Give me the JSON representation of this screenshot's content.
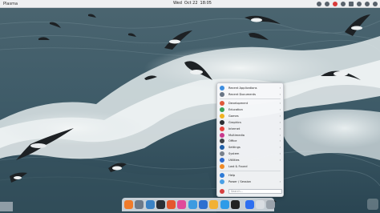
{
  "top_panel": {
    "activities_label": "Plasma",
    "clock": {
      "day": "Wed",
      "date": "Oct 22",
      "time": "18:05"
    }
  },
  "app_menu": {
    "items": [
      {
        "label": "Recent Applications",
        "color": "#3d8ee0",
        "arrow": "›"
      },
      {
        "label": "Recent Documents",
        "color": "#6a7686",
        "arrow": "›"
      },
      {
        "label": "Development",
        "color": "#e05a3b",
        "arrow": "›"
      },
      {
        "label": "Education",
        "color": "#3aa15a",
        "arrow": "›"
      },
      {
        "label": "Games",
        "color": "#f0b323",
        "arrow": "›"
      },
      {
        "label": "Graphics",
        "color": "#2c2f33",
        "arrow": "›"
      },
      {
        "label": "Internet",
        "color": "#e8453c",
        "arrow": "›"
      },
      {
        "label": "Multimedia",
        "color": "#c93a8d",
        "arrow": "›"
      },
      {
        "label": "Office",
        "color": "#3f4348",
        "arrow": "›"
      },
      {
        "label": "Settings",
        "color": "#1f5fa8",
        "arrow": "›"
      },
      {
        "label": "System",
        "color": "#7a828c",
        "arrow": "›"
      },
      {
        "label": "Utilities",
        "color": "#2e6bd0",
        "arrow": "›"
      },
      {
        "label": "Lost & Found",
        "color": "#f08a24",
        "arrow": ""
      },
      {
        "label": "Help",
        "color": "#2e7bd6",
        "arrow": ""
      },
      {
        "label": "Power / Session",
        "color": "#4aa0e6",
        "arrow": "›"
      }
    ],
    "search_placeholder": "Search..."
  },
  "dock": {
    "icons": [
      {
        "name": "firefox-icon",
        "color": "#f07b2a"
      },
      {
        "name": "files-icon",
        "color": "#6c7a8a"
      },
      {
        "name": "settings-icon",
        "color": "#3b82c4"
      },
      {
        "name": "terminal-icon",
        "color": "#2b2f36"
      },
      {
        "name": "browser-icon",
        "color": "#e4572e"
      },
      {
        "name": "music-icon",
        "color": "#e04a9a"
      },
      {
        "name": "globe-icon",
        "color": "#3c9be0"
      },
      {
        "name": "mail-icon",
        "color": "#2d6fd0"
      },
      {
        "name": "photos-icon",
        "color": "#f2b135"
      },
      {
        "name": "folder-icon",
        "color": "#2f9be8"
      },
      {
        "name": "ink-icon",
        "color": "#222222"
      },
      {
        "name": "app-menu-icon",
        "color": "#2e6ff0"
      },
      {
        "name": "discover-icon",
        "color": "#d9dde2"
      },
      {
        "name": "trash-icon",
        "color": "#9aa2ab"
      }
    ]
  }
}
